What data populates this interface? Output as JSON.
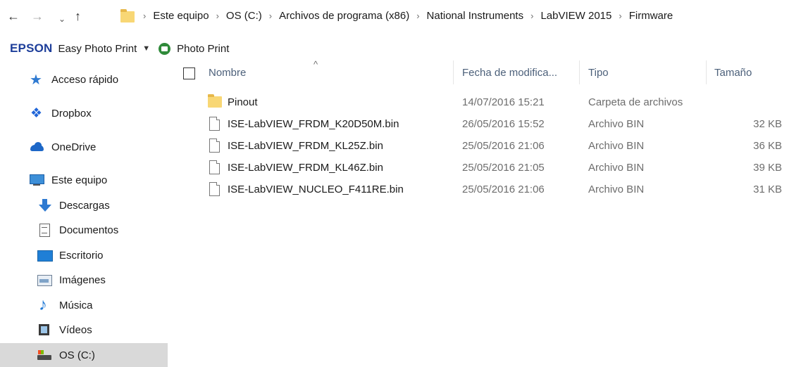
{
  "address_bar": {
    "back_icon": "arrow-left-icon",
    "forward_icon": "arrow-right-icon",
    "back_glyph": "←",
    "forward_glyph": "→",
    "recent_glyph": "⌄",
    "up_glyph": "↑",
    "breadcrumbs": [
      "Este equipo",
      "OS (C:)",
      "Archivos de programa (x86)",
      "National Instruments",
      "LabVIEW 2015",
      "Firmware"
    ],
    "separator": "›"
  },
  "epson_toolbar": {
    "logo": "EPSON",
    "easy_photo_print": "Easy Photo Print",
    "dropdown_glyph": "▼",
    "photo_print": "Photo Print",
    "brand_color": "#1d3e9a"
  },
  "sidebar": {
    "items": [
      {
        "label": "Acceso rápido",
        "icon": "star-icon"
      },
      {
        "label": "Dropbox",
        "icon": "dropbox-icon"
      },
      {
        "label": "OneDrive",
        "icon": "cloud-icon"
      },
      {
        "label": "Este equipo",
        "icon": "computer-icon"
      },
      {
        "label": "Descargas",
        "icon": "download-icon"
      },
      {
        "label": "Documentos",
        "icon": "document-icon"
      },
      {
        "label": "Escritorio",
        "icon": "desktop-icon"
      },
      {
        "label": "Imágenes",
        "icon": "pictures-icon"
      },
      {
        "label": "Música",
        "icon": "music-icon"
      },
      {
        "label": "Vídeos",
        "icon": "videos-icon"
      },
      {
        "label": "OS (C:)",
        "icon": "drive-icon",
        "selected": true
      }
    ]
  },
  "file_list": {
    "columns": {
      "name": "Nombre",
      "date": "Fecha de modifica...",
      "type": "Tipo",
      "size": "Tamaño"
    },
    "sort_glyph": "^",
    "header_color": "#4c607a",
    "rows": [
      {
        "name": "Pinout",
        "date": "14/07/2016 15:21",
        "type": "Carpeta de archivos",
        "size": "",
        "icon": "folder-icon"
      },
      {
        "name": "ISE-LabVIEW_FRDM_K20D50M.bin",
        "date": "26/05/2016 15:52",
        "type": "Archivo BIN",
        "size": "32 KB",
        "icon": "file-icon"
      },
      {
        "name": "ISE-LabVIEW_FRDM_KL25Z.bin",
        "date": "25/05/2016 21:06",
        "type": "Archivo BIN",
        "size": "36 KB",
        "icon": "file-icon"
      },
      {
        "name": "ISE-LabVIEW_FRDM_KL46Z.bin",
        "date": "25/05/2016 21:05",
        "type": "Archivo BIN",
        "size": "39 KB",
        "icon": "file-icon"
      },
      {
        "name": "ISE-LabVIEW_NUCLEO_F411RE.bin",
        "date": "25/05/2016 21:06",
        "type": "Archivo BIN",
        "size": "31 KB",
        "icon": "file-icon"
      }
    ]
  }
}
